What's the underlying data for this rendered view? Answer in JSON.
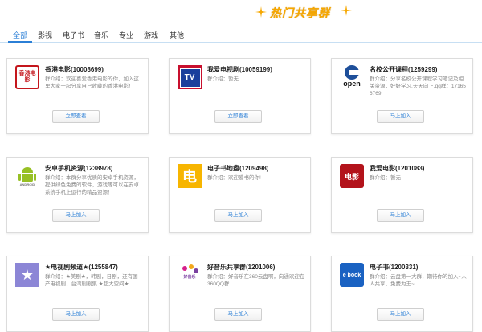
{
  "header": {
    "title": "热门共享群"
  },
  "tabs": [
    {
      "label": "全部"
    },
    {
      "label": "影视"
    },
    {
      "label": "电子书"
    },
    {
      "label": "音乐"
    },
    {
      "label": "专业"
    },
    {
      "label": "游戏"
    },
    {
      "label": "其他"
    }
  ],
  "cards": [
    {
      "name": "香港电影(10008699)",
      "desc": "群介绍：欢迎喜爱香港电影的你，加入这里大家一起分享自己收藏的香港电影！",
      "button": "立即查看",
      "icon": "hong-kong-movie-stamp-icon",
      "icon_text": "香港电影"
    },
    {
      "name": "我爱电视剧(10059199)",
      "desc": "群介绍：暂无",
      "button": "立即查看",
      "icon": "tv-icon",
      "icon_text": "TV"
    },
    {
      "name": "名校公开课程(1259299)",
      "desc": "群介绍：分享名校公开课程学习笔记及相关资源，好好学习,天天向上,qq群：17165 6769",
      "button": "马上加入",
      "icon": "open-course-icon",
      "icon_text": "open"
    },
    {
      "name": "安卓手机资源(1238978)",
      "desc": "群介绍：本群分享优质的安卓手机资源，提供绿色免费的软件，游戏等可以在安卓系统手机上运行的精品资源！",
      "button": "马上加入",
      "icon": "android-icon",
      "icon_text": "ANDROID"
    },
    {
      "name": "电子书地盘(1209498)",
      "desc": "群介绍：欢迎爱书的你!",
      "button": "马上加入",
      "icon": "ebook-char-icon",
      "icon_text": "电"
    },
    {
      "name": "我爱电影(1201083)",
      "desc": "群介绍：暂无",
      "button": "马上加入",
      "icon": "movie-stamp-icon",
      "icon_text": "电影"
    },
    {
      "name": "★电视剧频道★(1255847)",
      "desc": "群介绍：★美剧★，韩剧，日剧，还有国产电视剧，台湾剧剧集 ★超大空间★",
      "button": "马上加入",
      "icon": "star-icon",
      "icon_text": "★"
    },
    {
      "name": "好音乐共享群(1201006)",
      "desc": "群介绍：好音乐在360云盘啊，向通欢迎在360QQ群",
      "button": "马上加入",
      "icon": "music-share-icon",
      "icon_text": "好音乐"
    },
    {
      "name": "电子书(1200331)",
      "desc": "群介绍：云盘第一大群，期待你的加入~人人共享，免费为王~",
      "button": "马上加入",
      "icon": "ebook-icon",
      "icon_text": "e book"
    }
  ],
  "colors": {
    "accent": "#2b7fd6",
    "title": "#f6a700",
    "tab_line": "#c7dff3"
  }
}
